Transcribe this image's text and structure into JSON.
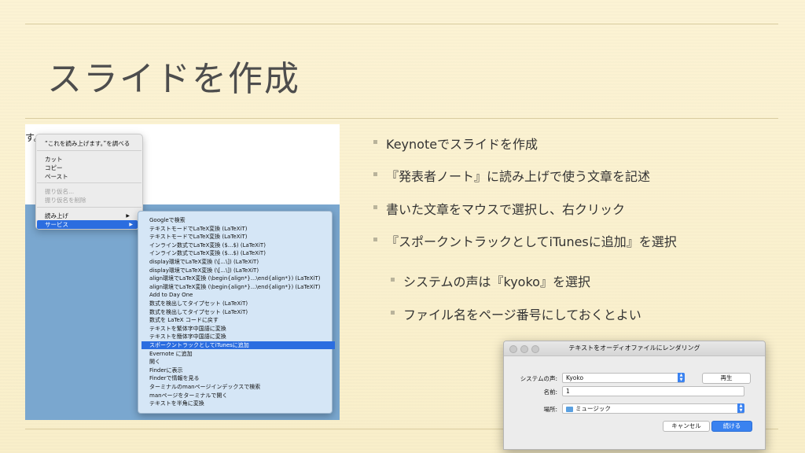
{
  "slide": {
    "title": "スライドを作成",
    "bullets": [
      "Keynoteでスライドを作成",
      "『発表者ノート』に読み上げで使う文章を記述",
      "書いた文章をマウスで選択し、右クリック",
      "『スポークントラックとしてiTunesに追加』を選択"
    ],
    "subbullets": [
      "システムの声は『kyoko』を選択",
      "ファイル名をページ番号にしておくとよい"
    ]
  },
  "screenshot": {
    "partial_text": "す。",
    "context_menu": [
      {
        "label": "“これを読み上げます。”を調べる",
        "state": "normal"
      },
      {
        "label": "カット",
        "state": "normal"
      },
      {
        "label": "コピー",
        "state": "normal"
      },
      {
        "label": "ペースト",
        "state": "normal"
      },
      {
        "label": "振り仮名...",
        "state": "disabled"
      },
      {
        "label": "振り仮名を削除",
        "state": "disabled"
      },
      {
        "label": "読み上げ",
        "state": "normal",
        "arrow": "▶"
      },
      {
        "label": "サービス",
        "state": "selected",
        "arrow": "▶"
      }
    ],
    "services_menu": [
      "Googleで検索",
      "テキストモードでLaTeX変換 (LaTeXiT)",
      "テキストモードでLaTeX変換 (LaTeXiT)",
      "インライン数式でLaTeX変換 ($...$) (LaTeXiT)",
      "インライン数式でLaTeX変換 ($...$) (LaTeXiT)",
      "display環境でLaTeX変換 (\\[...\\]) (LaTeXiT)",
      "display環境でLaTeX変換 (\\[...\\]) (LaTeXiT)",
      "align環境でLaTeX変換 (\\begin{align*}...\\end{align*}) (LaTeXiT)",
      "align環境でLaTeX変換 (\\begin{align*}...\\end{align*}) (LaTeXiT)",
      "Add to Day One",
      "数式を検出してタイプセット (LaTeXiT)",
      "数式を検出してタイプセット (LaTeXiT)",
      "数式を LaTeX コードに戻す",
      "テキストを繁体字中国語に変換",
      "テキストを簡体字中国語に変換",
      "スポークントラックとしてiTunesに追加",
      "Evernote に追加",
      "開く",
      "Finderに表示",
      "Finderで情報を見る",
      "ターミナルのmanページインデックスで検索",
      "manページをターミナルで開く",
      "テキストを半角に変換"
    ],
    "services_selected_index": 15
  },
  "dialog": {
    "title": "テキストをオーディオファイルにレンダリング",
    "voice_label": "システムの声:",
    "voice_value": "Kyoko",
    "play_button": "再生",
    "name_label": "名前:",
    "name_value": "1",
    "location_label": "場所:",
    "location_value": "ミュージック",
    "cancel_button": "キャンセル",
    "continue_button": "続ける"
  }
}
